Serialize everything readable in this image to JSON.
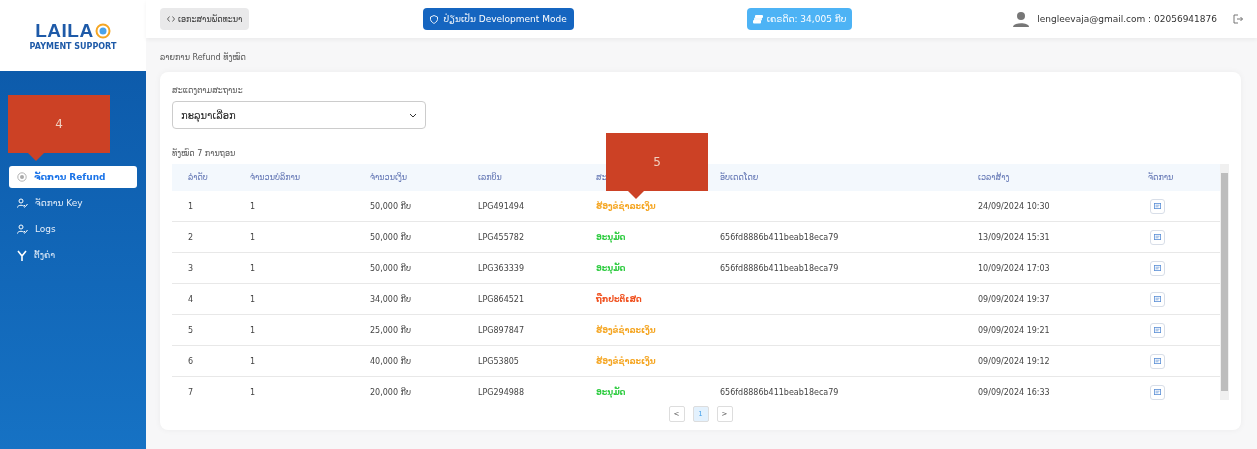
{
  "logo": {
    "text": "LAILA",
    "tagline": "PAYMENT SUPPORT"
  },
  "sidebar": {
    "items": [
      {
        "label": "ຈັດການ Refund",
        "kind": "refund",
        "selected": true
      },
      {
        "label": "ຈັດການ Key",
        "kind": "key",
        "selected": false
      },
      {
        "label": "Logs",
        "kind": "logs",
        "selected": false
      },
      {
        "label": "ຕັ້ງຄ່າ",
        "kind": "settings",
        "selected": false
      }
    ]
  },
  "topbar": {
    "docs_button": "ເອກະສານພັດທະນາ",
    "mode_button": "ປ່ຽນເປັນ Development Mode",
    "credit": "ເຄຣດິດ: 34,005 ກີບ",
    "user": "lengleevaja@gmail.com : 02056941876"
  },
  "breadcrumb": "ລາຍການ Refund ທັງໝົດ",
  "filter": {
    "label": "ສະແດງຕາມສະຖານະ",
    "value": "ກະລຸນາເລືອກ"
  },
  "total": "ທັງໝົດ 7 ການຖອນ",
  "table": {
    "columns": [
      "ລຳດັບ",
      "ຈຳນວນບໍລິການ",
      "ຈຳນວນເງິນ",
      "ເລກບິນ",
      "ສະ",
      "ອັບເດດໂດຍ",
      "ເວລາສ້າງ",
      "ຈັດການ"
    ],
    "rows": [
      {
        "no": "1",
        "count": "1",
        "amount": "50,000 ກີບ",
        "bill": "LPG491494",
        "status": "ຮ້ອງຂໍຊຳລະເງິນ",
        "color": "#f5a623",
        "created": "24/09/2024 10:30"
      },
      {
        "no": "2",
        "count": "1",
        "amount": "50,000 ກີບ",
        "bill": "LPG455782",
        "status": "ອະນຸມັດ",
        "color": "#2ecc40",
        "updated_by": "656fd8886b411beab18eca79",
        "created": "13/09/2024 15:31"
      },
      {
        "no": "3",
        "count": "1",
        "amount": "50,000 ກີບ",
        "bill": "LPG363339",
        "status": "ອະນຸມັດ",
        "color": "#2ecc40",
        "updated_by": "656fd8886b411beab18eca79",
        "created": "10/09/2024 17:03"
      },
      {
        "no": "4",
        "count": "1",
        "amount": "34,000 ກີບ",
        "bill": "LPG864521",
        "status": "ຖືກປະຕິເສດ",
        "color": "#f0501e",
        "created": "09/09/2024 19:37"
      },
      {
        "no": "5",
        "count": "1",
        "amount": "25,000 ກີບ",
        "bill": "LPG897847",
        "status": "ຮ້ອງຂໍຊຳລະເງິນ",
        "color": "#f5a623",
        "created": "09/09/2024 19:21"
      },
      {
        "no": "6",
        "count": "1",
        "amount": "40,000 ກີບ",
        "bill": "LPG53805",
        "status": "ຮ້ອງຂໍຊຳລະເງິນ",
        "color": "#f5a623",
        "created": "09/09/2024 19:12"
      },
      {
        "no": "7",
        "count": "1",
        "amount": "20,000 ກີບ",
        "bill": "LPG294988",
        "status": "ອະນຸມັດ",
        "color": "#2ecc40",
        "updated_by": "656fd8886b411beab18eca79",
        "created": "09/09/2024 16:33"
      }
    ]
  },
  "pagination": {
    "prev": "<",
    "pages": [
      {
        "label": "1",
        "selected": true
      }
    ],
    "next": ">"
  },
  "callouts": [
    {
      "text": "4"
    },
    {
      "text": "5"
    }
  ]
}
